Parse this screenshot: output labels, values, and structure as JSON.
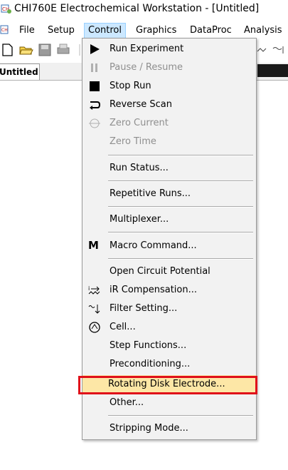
{
  "window": {
    "title": "CHI760E Electrochemical Workstation - [Untitled]"
  },
  "menubar": {
    "items": [
      {
        "label": "File"
      },
      {
        "label": "Setup"
      },
      {
        "label": "Control"
      },
      {
        "label": "Graphics"
      },
      {
        "label": "DataProc"
      },
      {
        "label": "Analysis"
      }
    ]
  },
  "document": {
    "tab_label": "Untitled"
  },
  "control_menu": {
    "items": [
      {
        "label": "Run Experiment",
        "enabled": true,
        "icon": "play-icon"
      },
      {
        "label": "Pause / Resume",
        "enabled": false,
        "icon": "pause-icon"
      },
      {
        "label": "Stop Run",
        "enabled": true,
        "icon": "stop-icon"
      },
      {
        "label": "Reverse Scan",
        "enabled": true,
        "icon": "reverse-icon"
      },
      {
        "label": "Zero Current",
        "enabled": false,
        "icon": "zero-current-icon"
      },
      {
        "label": "Zero Time",
        "enabled": false
      },
      {
        "label": "Run Status...",
        "enabled": true
      },
      {
        "label": "Repetitive Runs...",
        "enabled": true
      },
      {
        "label": "Multiplexer...",
        "enabled": true
      },
      {
        "label": "Macro Command...",
        "enabled": true,
        "icon": "macro-icon",
        "icon_text": "M"
      },
      {
        "label": "Open Circuit Potential",
        "enabled": true
      },
      {
        "label": "iR Compensation...",
        "enabled": true,
        "icon": "ir-compensation-icon"
      },
      {
        "label": "Filter Setting...",
        "enabled": true,
        "icon": "filter-icon"
      },
      {
        "label": "Cell...",
        "enabled": true,
        "icon": "cell-icon"
      },
      {
        "label": "Step Functions...",
        "enabled": true
      },
      {
        "label": "Preconditioning...",
        "enabled": true
      },
      {
        "label": "Rotating Disk Electrode...",
        "enabled": true,
        "highlighted": true
      },
      {
        "label": "Other...",
        "enabled": true
      },
      {
        "label": "Stripping Mode...",
        "enabled": true
      }
    ]
  },
  "colors": {
    "highlight": "#fde7a6",
    "annotation_border": "#e0101a",
    "active_menu": "#cce8ff"
  }
}
